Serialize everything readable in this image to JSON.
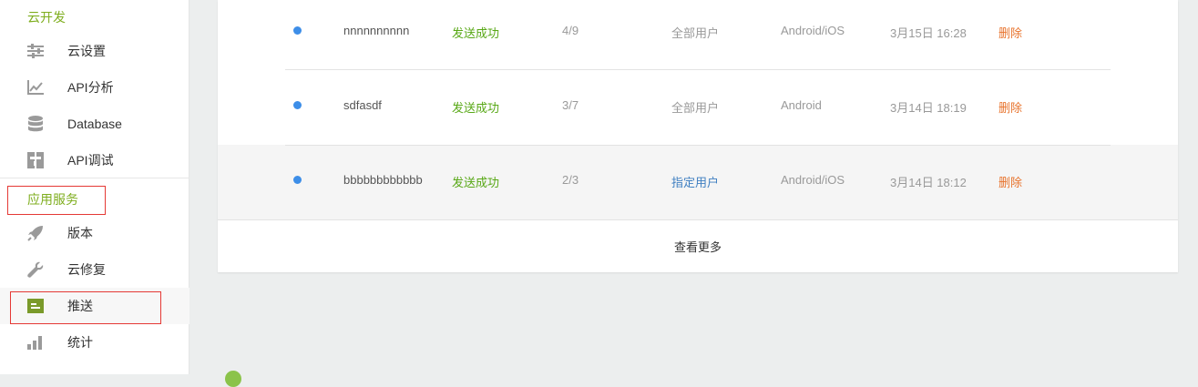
{
  "sidebar": {
    "section_cloud": "云开发",
    "cloud_items": [
      {
        "label": "云设置",
        "icon": "sliders-icon"
      },
      {
        "label": "API分析",
        "icon": "line-chart-icon"
      },
      {
        "label": "Database",
        "icon": "database-icon"
      },
      {
        "label": "API调试",
        "icon": "debug-icon"
      }
    ],
    "section_app": "应用服务",
    "app_items": [
      {
        "label": "版本",
        "icon": "rocket-icon"
      },
      {
        "label": "云修复",
        "icon": "wrench-icon"
      },
      {
        "label": "推送",
        "icon": "push-icon",
        "active": true
      },
      {
        "label": "统计",
        "icon": "bar-chart-icon"
      }
    ]
  },
  "push_list": {
    "rows": [
      {
        "name": "nnnnnnnnnn",
        "status": "发送成功",
        "count": "4/9",
        "target": "全部用户",
        "platform": "Android/iOS",
        "time": "3月15日 16:28",
        "action": "删除"
      },
      {
        "name": "sdfasdf",
        "status": "发送成功",
        "count": "3/7",
        "target": "全部用户",
        "platform": "Android",
        "time": "3月14日 18:19",
        "action": "删除"
      },
      {
        "name": "bbbbbbbbbbbb",
        "status": "发送成功",
        "count": "2/3",
        "target": "指定用户",
        "platform": "Android/iOS",
        "time": "3月14日 18:12",
        "action": "删除"
      }
    ],
    "more_label": "查看更多"
  },
  "colors": {
    "brand_green": "#7fae1f",
    "status_green": "#58a816",
    "link_blue": "#3f7fc1",
    "delete_orange": "#e8742e",
    "dot_blue": "#3d8ee8",
    "highlight_red": "#e53935"
  }
}
